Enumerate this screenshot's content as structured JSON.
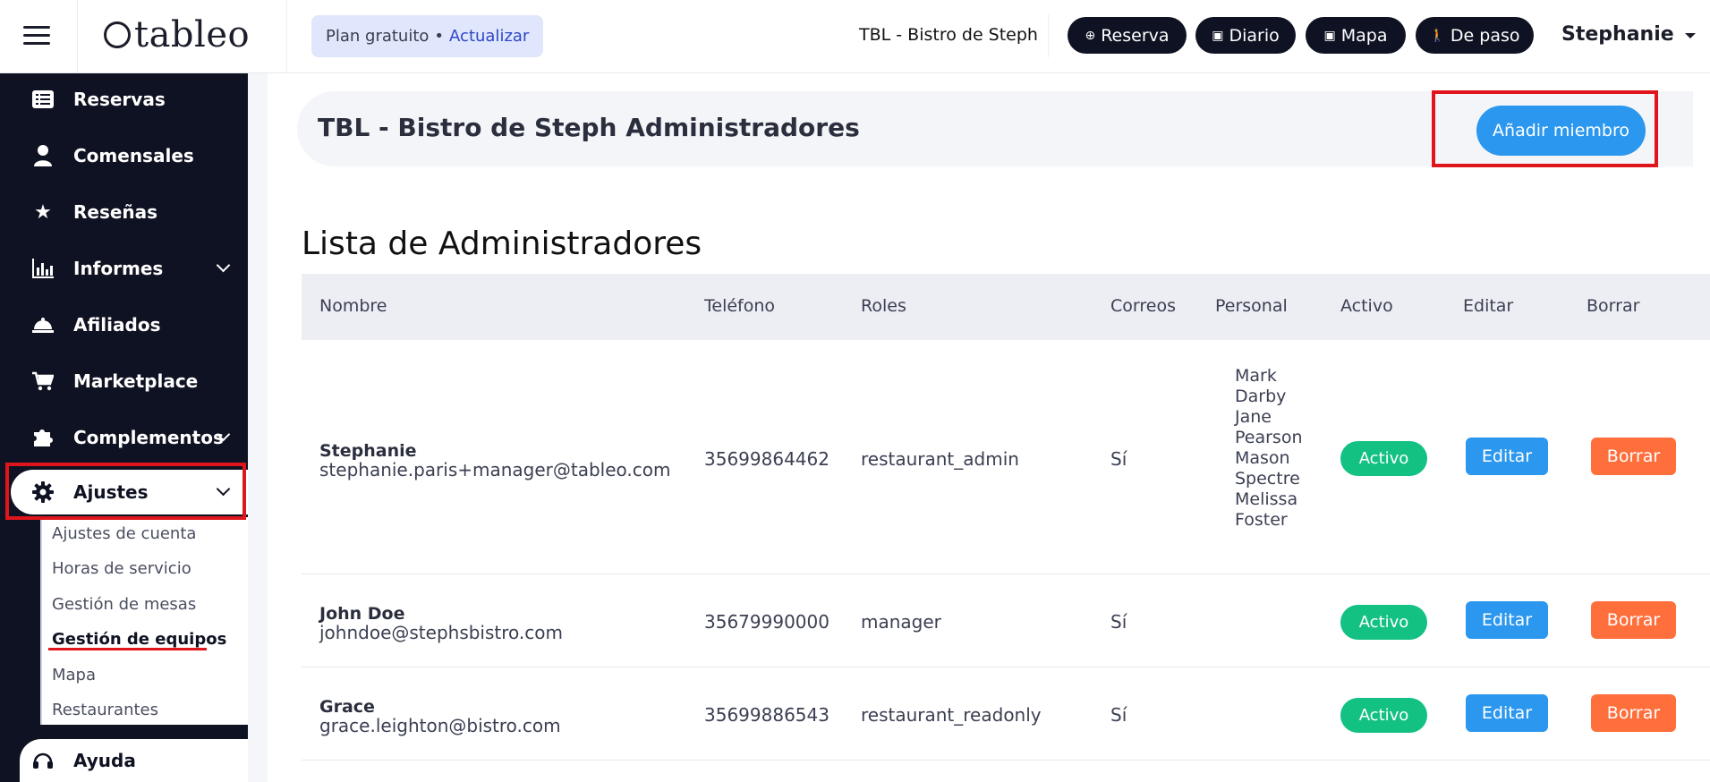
{
  "topbar": {
    "logo_text": "tableo",
    "plan_label": "Plan gratuito",
    "plan_separator": "•",
    "plan_upgrade": "Actualizar",
    "restaurant_name": "TBL - Bistro de Steph",
    "actions": [
      {
        "label": "Reserva",
        "icon": "plus-circle-icon"
      },
      {
        "label": "Diario",
        "icon": "calendar-icon"
      },
      {
        "label": "Mapa",
        "icon": "calendar-icon"
      },
      {
        "label": "De paso",
        "icon": "walking-icon"
      }
    ],
    "user_name": "Stephanie"
  },
  "sidebar": {
    "items": [
      {
        "label": "Reservas",
        "icon": "list-icon"
      },
      {
        "label": "Comensales",
        "icon": "person-icon"
      },
      {
        "label": "Reseñas",
        "icon": "star-icon"
      },
      {
        "label": "Informes",
        "icon": "bar-chart-icon"
      },
      {
        "label": "Afiliados",
        "icon": "cloche-icon"
      },
      {
        "label": "Marketplace",
        "icon": "cart-icon"
      },
      {
        "label": "Complementos",
        "icon": "puzzle-icon"
      },
      {
        "label": "Ajustes",
        "icon": "gear-icon"
      }
    ],
    "subitems": [
      {
        "label": "Ajustes de cuenta"
      },
      {
        "label": "Horas de servicio"
      },
      {
        "label": "Gestión de mesas"
      },
      {
        "label": "Gestión de equipos"
      },
      {
        "label": "Mapa"
      },
      {
        "label": "Restaurantes"
      }
    ],
    "help": {
      "label": "Ayuda",
      "icon": "headset-icon"
    }
  },
  "main": {
    "header_title": "TBL - Bistro de Steph Administradores",
    "add_button": "Añadir miembro",
    "list_title": "Lista de Administradores",
    "columns": [
      "Nombre",
      "Teléfono",
      "Roles",
      "Correos",
      "Personal",
      "Activo",
      "Editar",
      "Borrar"
    ],
    "rows": [
      {
        "name": "Stephanie",
        "email": "stephanie.paris+manager@tableo.com",
        "phone": "35699864462",
        "role": "restaurant_admin",
        "emails": "Sí",
        "staff": [
          "Mark",
          "Darby",
          "Jane",
          "Pearson",
          "Mason",
          "Spectre",
          "Melissa",
          "Foster"
        ],
        "active": "Activo",
        "edit": "Editar",
        "delete": "Borrar"
      },
      {
        "name": "John Doe",
        "email": "johndoe@stephsbistro.com",
        "phone": "35679990000",
        "role": "manager",
        "emails": "Sí",
        "staff": [],
        "active": "Activo",
        "edit": "Editar",
        "delete": "Borrar"
      },
      {
        "name": "Grace",
        "email": "grace.leighton@bistro.com",
        "phone": "35699886543",
        "role": "restaurant_readonly",
        "emails": "Sí",
        "staff": [],
        "active": "Activo",
        "edit": "Editar",
        "delete": "Borrar"
      }
    ]
  },
  "colors": {
    "sidebar_bg": "#0f1222",
    "primary": "#2b97ee",
    "success": "#13c183",
    "danger": "#ff6f3c",
    "highlight": "#e0151b"
  }
}
